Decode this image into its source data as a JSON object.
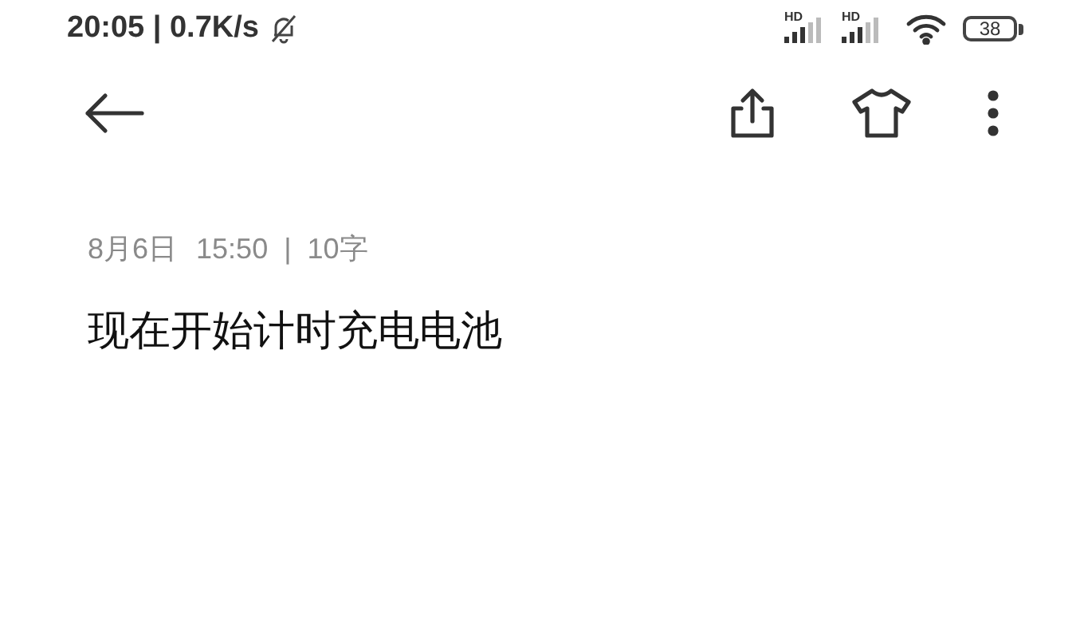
{
  "status_bar": {
    "time_speed": "20:05 | 0.7K/s",
    "signals": [
      {
        "label": "HD"
      },
      {
        "label": "HD"
      }
    ],
    "battery": "38"
  },
  "note": {
    "date": "8月6日",
    "time": "15:50",
    "separator": "|",
    "count": "10字",
    "text": "现在开始计时充电电池"
  }
}
